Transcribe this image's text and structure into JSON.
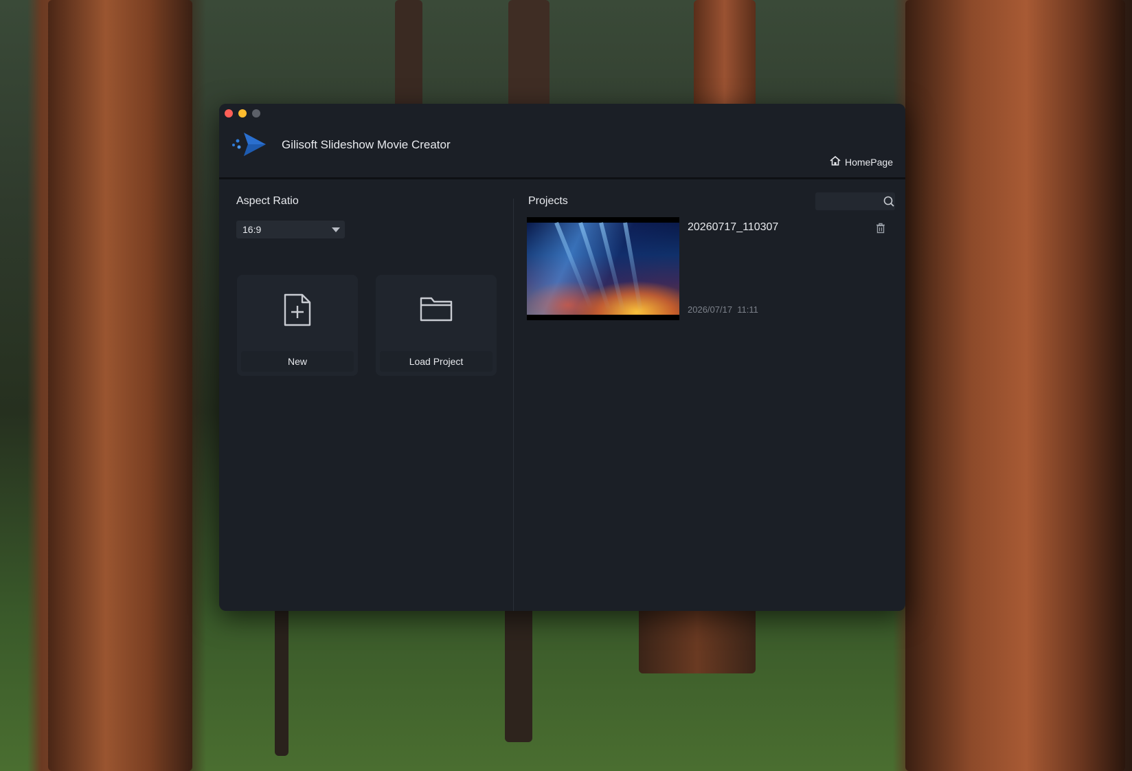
{
  "window": {
    "title": "Gilisoft Slideshow Movie Creator",
    "homepage_label": "HomePage"
  },
  "left_panel": {
    "aspect_ratio_label": "Aspect Ratio",
    "aspect_ratio_value": "16:9",
    "new_label": "New",
    "load_project_label": "Load Project"
  },
  "projects_panel": {
    "label": "Projects",
    "search_placeholder": "",
    "items": [
      {
        "name": "20260717_110307",
        "date": "2026/07/17  11:11"
      }
    ]
  },
  "colors": {
    "window_bg": "#1b1f26",
    "accent_logo": "#2f7bd9",
    "text_primary": "#e8eaee",
    "text_secondary": "#7c818a"
  },
  "icons": {
    "logo": "app-logo-play-icon",
    "home": "home-icon",
    "new": "new-file-plus-icon",
    "load": "folder-icon",
    "search": "search-icon",
    "delete": "trash-icon",
    "dropdown": "chevron-down-icon"
  }
}
